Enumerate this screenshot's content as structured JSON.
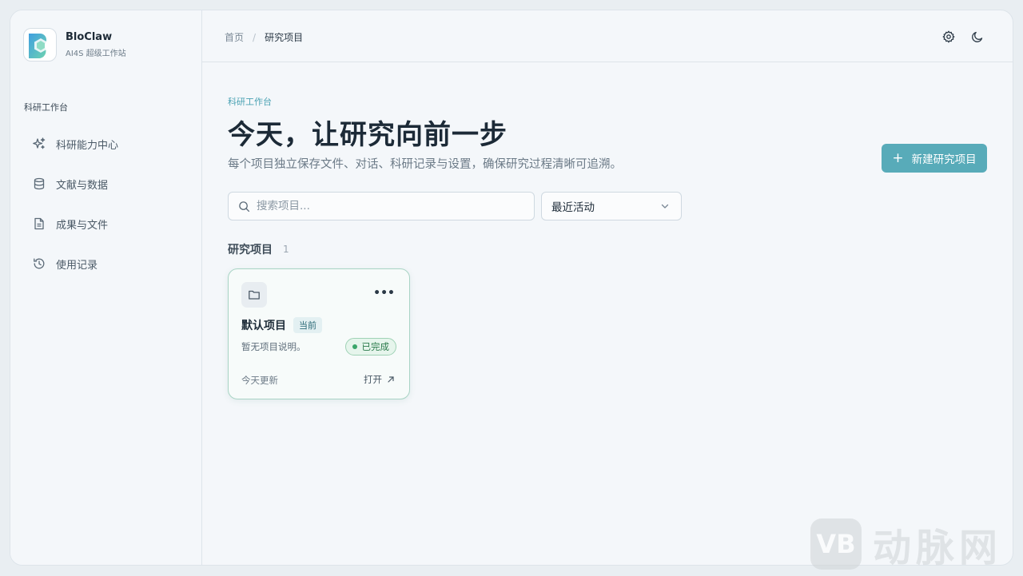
{
  "brand": {
    "name": "BloClaw",
    "subtitle": "AI4S 超级工作站"
  },
  "sidebar": {
    "section_label": "科研工作台",
    "items": [
      {
        "label": "科研能力中心",
        "icon": "sparkles-icon"
      },
      {
        "label": "文献与数据",
        "icon": "database-icon"
      },
      {
        "label": "成果与文件",
        "icon": "document-icon"
      },
      {
        "label": "使用记录",
        "icon": "history-icon"
      }
    ]
  },
  "header": {
    "breadcrumb": {
      "home": "首页",
      "separator": "/",
      "current": "研究项目"
    },
    "icons": [
      "settings-icon",
      "moon-icon"
    ]
  },
  "hero": {
    "eyebrow": "科研工作台",
    "title": "今天，让研究向前一步",
    "subtitle": "每个项目独立保存文件、对话、科研记录与设置，确保研究过程清晰可追溯。",
    "new_button": "新建研究项目"
  },
  "filters": {
    "search_placeholder": "搜索项目...",
    "sort_value": "最近活动"
  },
  "projects": {
    "title": "研究项目",
    "count": "1",
    "items": [
      {
        "name": "默认项目",
        "current_badge": "当前",
        "description": "暂无项目说明。",
        "status": "已完成",
        "updated": "今天更新",
        "open_label": "打开"
      }
    ]
  },
  "watermark": {
    "logo_text": "VB",
    "text": "动脉网"
  },
  "colors": {
    "accent": "#58abb9",
    "success": "#3aa66a",
    "card_border": "#a9d4c5"
  }
}
